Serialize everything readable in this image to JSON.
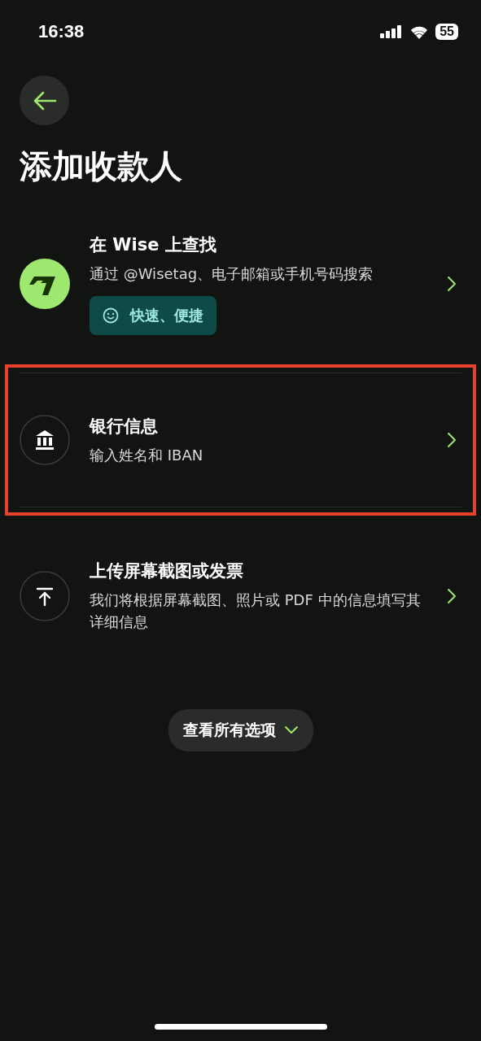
{
  "status_bar": {
    "time": "16:38",
    "battery": "55"
  },
  "title": "添加收款人",
  "options": [
    {
      "kind": "wise",
      "title": "在 Wise 上查找",
      "subtitle": "通过 @Wisetag、电子邮箱或手机号码搜索",
      "tag": "快速、便捷",
      "highlighted": false
    },
    {
      "kind": "bank",
      "title": "银行信息",
      "subtitle": "输入姓名和 IBAN",
      "highlighted": true
    },
    {
      "kind": "upload",
      "title": "上传屏幕截图或发票",
      "subtitle": "我们将根据屏幕截图、照片或 PDF 中的信息填写其详细信息",
      "highlighted": false
    }
  ],
  "more_button": "查看所有选项"
}
